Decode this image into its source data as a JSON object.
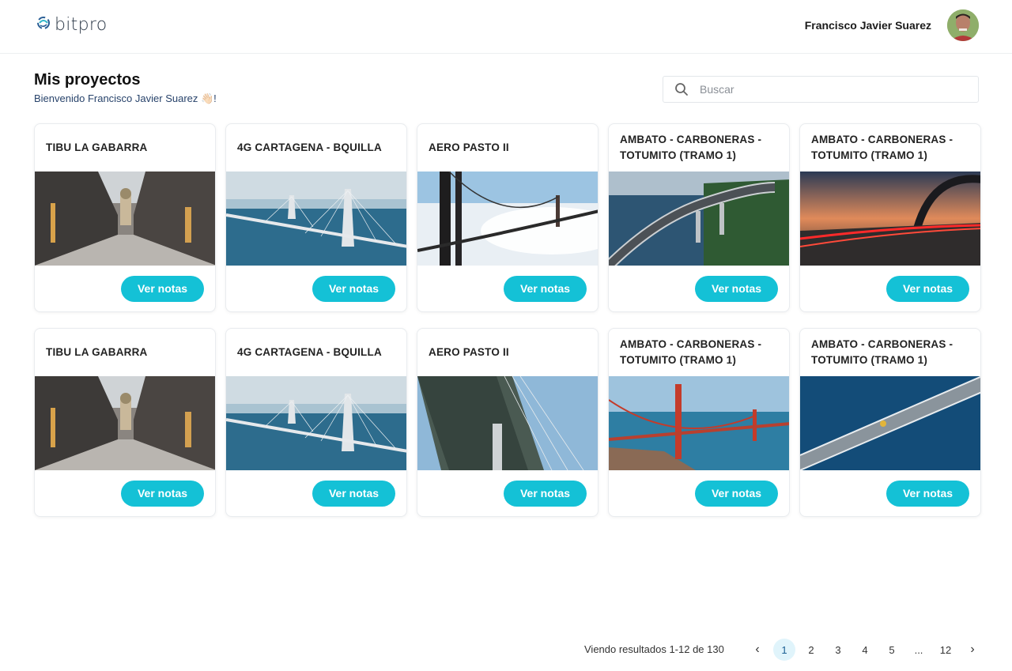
{
  "header": {
    "logo_text": "bitpro",
    "user_name": "Francisco Javier Suarez"
  },
  "page": {
    "title": "Mis proyectos",
    "welcome": "Bienvenido Francisco Javier Suarez 👋🏻!"
  },
  "search": {
    "placeholder": "Buscar"
  },
  "projects": [
    {
      "title": "TIBU LA GABARRA",
      "image": "city-street",
      "button": "Ver notas"
    },
    {
      "title": "4G CARTAGENA - BQUILLA",
      "image": "cable-bridge-water",
      "button": "Ver notas"
    },
    {
      "title": "AERO PASTO II",
      "image": "suspension-bridge-fog",
      "button": "Ver notas"
    },
    {
      "title": "AMBATO - CARBONERAS - TOTUMITO (TRAMO 1)",
      "image": "coastal-highway",
      "button": "Ver notas"
    },
    {
      "title": "AMBATO - CARBONERAS - TOTUMITO (TRAMO 1)",
      "image": "arch-bridge-sunset",
      "button": "Ver notas"
    },
    {
      "title": "TIBU LA GABARRA",
      "image": "city-street",
      "button": "Ver notas"
    },
    {
      "title": "4G CARTAGENA - BQUILLA",
      "image": "cable-bridge-water",
      "button": "Ver notas"
    },
    {
      "title": "AERO PASTO II",
      "image": "bridge-underside",
      "button": "Ver notas"
    },
    {
      "title": "AMBATO - CARBONERAS - TOTUMITO (TRAMO 1)",
      "image": "golden-gate-bridge",
      "button": "Ver notas"
    },
    {
      "title": "AMBATO - CARBONERAS - TOTUMITO (TRAMO 1)",
      "image": "aerial-bridge-person",
      "button": "Ver notas"
    }
  ],
  "pagination": {
    "results_text": "Viendo resultados 1-12 de 130",
    "prev_icon": "chevron-left-icon",
    "pages": [
      "1",
      "2",
      "3",
      "4",
      "5",
      "...",
      "12"
    ],
    "active_page": "1",
    "next_icon": "chevron-right-icon"
  },
  "colors": {
    "accent": "#14c1d6",
    "active_page_bg": "#e0f4fb",
    "welcome_text": "#28436b"
  }
}
